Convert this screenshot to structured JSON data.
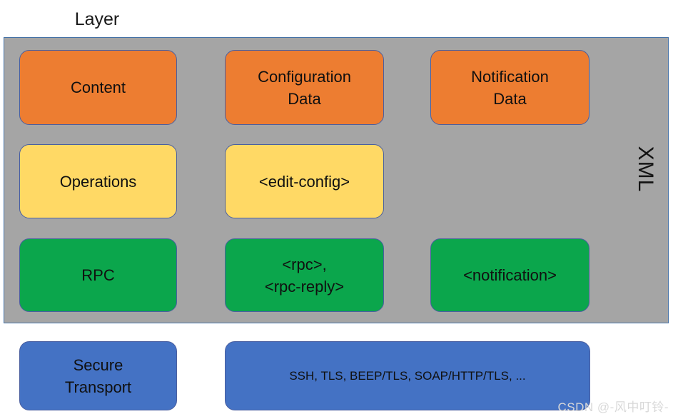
{
  "diagram": {
    "title": "Layer",
    "panel_label": "XML",
    "watermark": "CSDN @-风中叮铃-",
    "colors": {
      "panel_fill": "#a5a5a5",
      "panel_border": "#4472a8",
      "orange": "#ED7D31",
      "yellow": "#FFD965",
      "green": "#0BA64C",
      "blue": "#4472C4",
      "node_border": "#4a5fa0",
      "text": "#101010",
      "watermark": "#d8d8d8"
    },
    "rows": [
      {
        "id": "content-layer",
        "color": "orange",
        "nodes": [
          {
            "id": "content",
            "lines": [
              "Content"
            ]
          },
          {
            "id": "configuration-data",
            "lines": [
              "Configuration",
              "Data"
            ]
          },
          {
            "id": "notification-data",
            "lines": [
              "Notification",
              "Data"
            ]
          }
        ]
      },
      {
        "id": "operations-layer",
        "color": "yellow",
        "nodes": [
          {
            "id": "operations",
            "lines": [
              "Operations"
            ]
          },
          {
            "id": "edit-config",
            "lines": [
              "<edit-config>"
            ]
          }
        ]
      },
      {
        "id": "rpc-layer",
        "color": "green",
        "nodes": [
          {
            "id": "rpc",
            "lines": [
              "RPC"
            ]
          },
          {
            "id": "rpc-messages",
            "lines": [
              "<rpc>,",
              "<rpc-reply>"
            ]
          },
          {
            "id": "notification",
            "lines": [
              "<notification>"
            ]
          }
        ]
      },
      {
        "id": "secure-transport-layer",
        "color": "blue",
        "nodes": [
          {
            "id": "secure-transport",
            "lines": [
              "Secure",
              "Transport"
            ]
          },
          {
            "id": "transport-protocols",
            "lines": [
              "SSH, TLS, BEEP/TLS, SOAP/HTTP/TLS, ..."
            ]
          }
        ]
      }
    ]
  }
}
